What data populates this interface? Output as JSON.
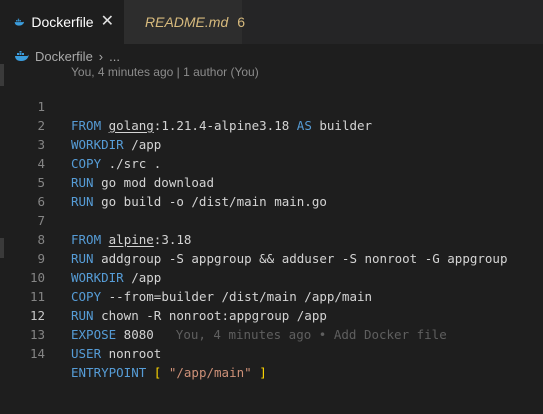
{
  "tabs": [
    {
      "label": "Dockerfile",
      "close_glyph": "✕",
      "icon": "docker-icon"
    },
    {
      "label": "README.md",
      "badge": "6",
      "icon": "info-icon"
    }
  ],
  "breadcrumb": {
    "file": "Dockerfile",
    "sep": "›",
    "more": "..."
  },
  "blame_header": "You, 4 minutes ago | 1 author (You)",
  "line_numbers": [
    "1",
    "2",
    "3",
    "4",
    "5",
    "6",
    "7",
    "8",
    "9",
    "10",
    "11",
    "12",
    "13",
    "14"
  ],
  "code": {
    "l1": {
      "kw": "FROM",
      "image": "golang",
      "rest": ":1.21.4-alpine3.18 ",
      "as": "AS",
      "name": " builder"
    },
    "l2": {
      "kw": "WORKDIR",
      "rest": " /app"
    },
    "l3": {
      "kw": "COPY",
      "rest": " ./src ."
    },
    "l4": {
      "kw": "RUN",
      "rest": " go mod download"
    },
    "l5": {
      "kw": "RUN",
      "rest": " go build -o /dist/main main.go"
    },
    "l7": {
      "kw": "FROM",
      "image": "alpine",
      "rest": ":3.18"
    },
    "l8": {
      "kw": "RUN",
      "rest": " addgroup -S appgroup && adduser -S nonroot -G appgroup"
    },
    "l9": {
      "kw": "WORKDIR",
      "rest": " /app"
    },
    "l10": {
      "kw": "COPY",
      "rest": " --from=builder /dist/main /app/main"
    },
    "l11": {
      "kw": "RUN",
      "rest": " chown -R nonroot:appgroup /app"
    },
    "l12": {
      "kw": "EXPOSE",
      "rest": " 8080",
      "ghost": "You, 4 minutes ago • Add Docker file"
    },
    "l13": {
      "kw": "USER",
      "rest": " nonroot"
    },
    "l14": {
      "kw": "ENTRYPOINT",
      "open": "[",
      "str": "\"/app/main\"",
      "close": "]"
    }
  },
  "current_line": "12",
  "colors": {
    "keyword": "#569cd6",
    "string": "#ce9178",
    "bracket": "#ffd700",
    "warning": "#d7ba7d"
  }
}
